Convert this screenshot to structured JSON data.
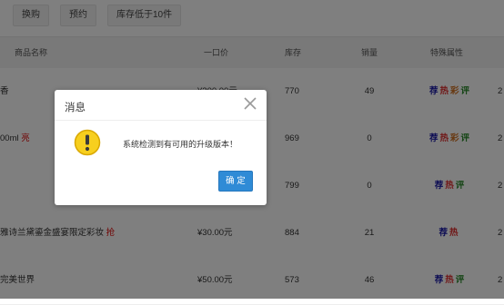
{
  "filters": [
    "",
    "换购",
    "预约",
    "库存低于10件"
  ],
  "table": {
    "headers": [
      "商品名称",
      "一口价",
      "库存",
      "销量",
      "特殊属性"
    ],
    "rows": [
      {
        "name": "香",
        "hot": "",
        "price": "¥200.00元",
        "stock": "770",
        "sales": "49",
        "tags": [
          "荐",
          "热",
          "彩",
          "评"
        ],
        "edge": "2"
      },
      {
        "name": "00ml ",
        "hot": "亮",
        "price": "",
        "stock": "969",
        "sales": "0",
        "tags": [
          "荐",
          "热",
          "彩",
          "评"
        ],
        "edge": "2"
      },
      {
        "name": "",
        "hot": "",
        "price": "",
        "stock": "799",
        "sales": "0",
        "tags": [
          "荐",
          "热",
          "评"
        ],
        "edge": "2"
      },
      {
        "name": " 雅诗兰黛鎏金盛宴限定彩妆 ",
        "hot": "抢",
        "price": "¥30.00元",
        "stock": "884",
        "sales": "21",
        "tags": [
          "荐",
          "热"
        ],
        "edge": "2"
      },
      {
        "name": "完美世界",
        "hot": "",
        "price": "¥50.00元",
        "stock": "573",
        "sales": "46",
        "tags": [
          "荐",
          "热",
          "评"
        ],
        "edge": "2"
      }
    ]
  },
  "dialog": {
    "title": "消息",
    "message": "系统检测到有可用的升级版本！",
    "ok_label": "确 定",
    "icon": "warning-icon",
    "close_icon": "close-icon"
  },
  "colors": {
    "accent": "#2f8bd6",
    "warning": "#f2c40f",
    "tag_recommend": "#1a1aa8",
    "tag_hot": "#e03030",
    "tag_color": "#d07020",
    "tag_review": "#2a8a2a"
  }
}
